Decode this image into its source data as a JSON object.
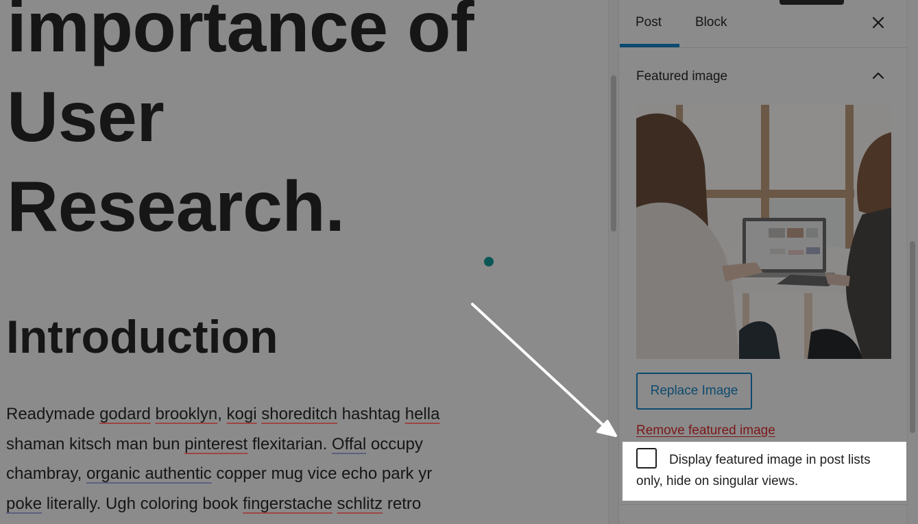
{
  "editor": {
    "title_lines": [
      "importance of",
      "User",
      "Research."
    ],
    "heading": "Introduction",
    "paragraph_lines": [
      [
        {
          "text": "Readymade ",
          "spell": ""
        },
        {
          "text": "godard",
          "spell": "red"
        },
        {
          "text": " ",
          "spell": ""
        },
        {
          "text": "brooklyn",
          "spell": "red"
        },
        {
          "text": ", ",
          "spell": ""
        },
        {
          "text": "kogi",
          "spell": "red"
        },
        {
          "text": " ",
          "spell": ""
        },
        {
          "text": "shoreditch",
          "spell": "red"
        },
        {
          "text": " hashtag ",
          "spell": ""
        },
        {
          "text": "hella",
          "spell": "red"
        }
      ],
      [
        {
          "text": "shaman kitsch man bun ",
          "spell": ""
        },
        {
          "text": "pinterest",
          "spell": "red"
        },
        {
          "text": " flexitarian. ",
          "spell": ""
        },
        {
          "text": "Offal",
          "spell": "blue"
        },
        {
          "text": " occupy",
          "spell": ""
        }
      ],
      [
        {
          "text": "chambray, ",
          "spell": ""
        },
        {
          "text": "organic authentic",
          "spell": "blue"
        },
        {
          "text": " copper mug vice echo park yr",
          "spell": ""
        }
      ],
      [
        {
          "text": "poke",
          "spell": "blue"
        },
        {
          "text": " literally. Ugh coloring book ",
          "spell": ""
        },
        {
          "text": "fingerstache",
          "spell": "red"
        },
        {
          "text": " ",
          "spell": ""
        },
        {
          "text": "schlitz",
          "spell": "red"
        },
        {
          "text": " retro",
          "spell": ""
        }
      ]
    ]
  },
  "sidebar": {
    "tabs": [
      {
        "label": "Post",
        "active": true
      },
      {
        "label": "Block",
        "active": false
      }
    ],
    "close_icon": "close-icon",
    "panel": {
      "title": "Featured image",
      "expanded": true,
      "toggle_icon": "chevron-up-icon",
      "image_alt": "Two women looking at a laptop by a window",
      "replace_label": "Replace Image",
      "remove_label": "Remove featured image",
      "checkbox": {
        "label": "Display featured image in post lists only, hide on singular views.",
        "checked": false
      }
    }
  },
  "colors": {
    "accent": "#0a4b73",
    "remove_link": "#7c1719",
    "cursor_dot": "#0b5756",
    "overlay_gray": "#8b8b8b",
    "highlight": "#ffffff"
  },
  "annotation": {
    "type": "arrow",
    "color": "#ffffff",
    "points_to": "display-featured-image-checkbox"
  }
}
